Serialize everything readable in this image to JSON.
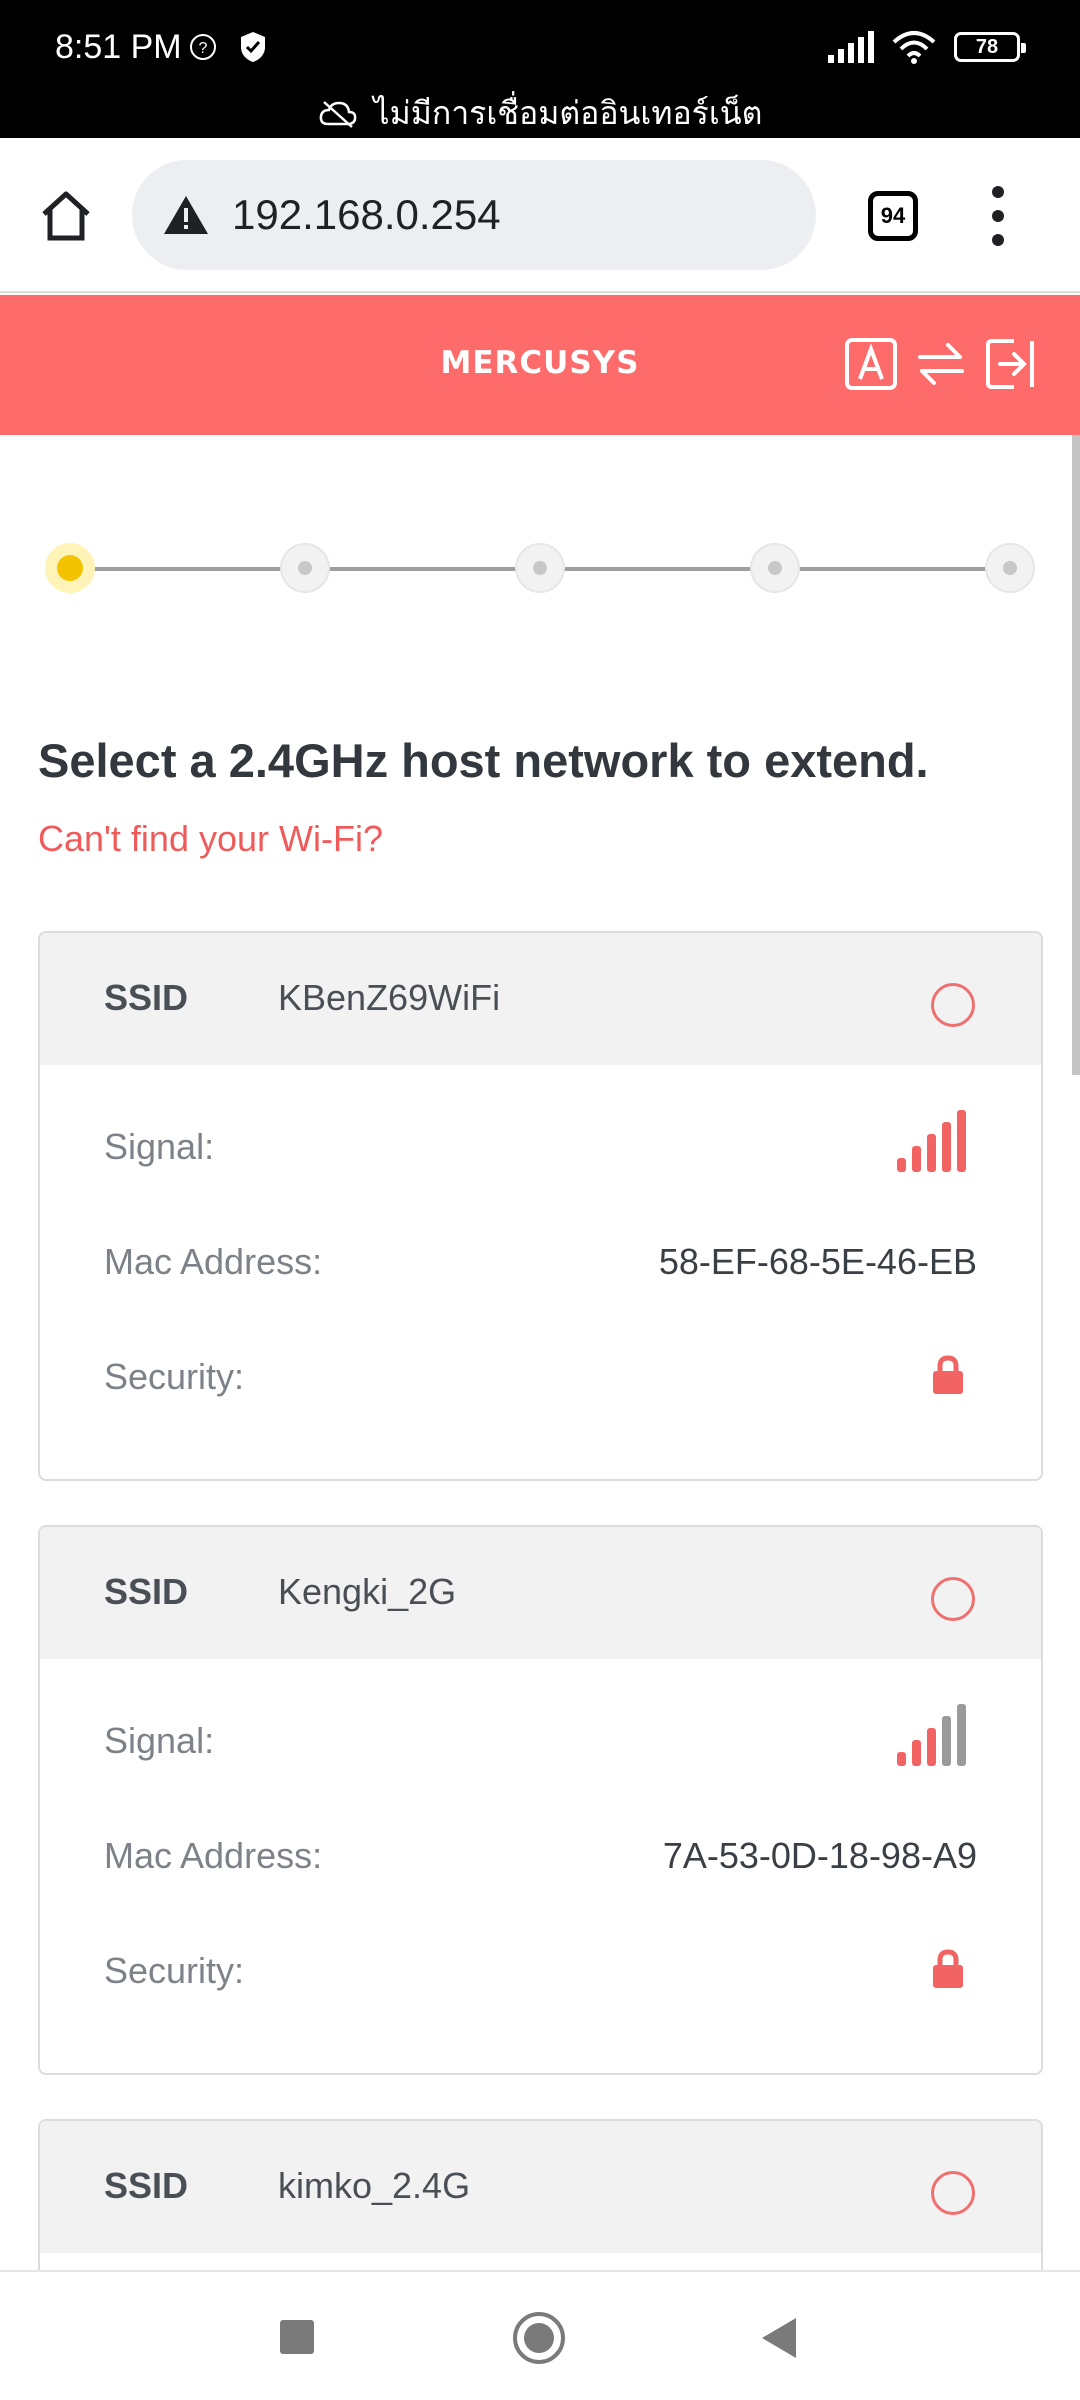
{
  "status_bar": {
    "time": "8:51 PM",
    "battery": "78",
    "notice": "ไม่มีการเชื่อมต่ออินเทอร์เน็ต",
    "icons": [
      "help-icon",
      "shield-icon",
      "cellular-signal-icon",
      "wifi-icon",
      "battery-icon",
      "cloud-off-icon"
    ]
  },
  "browser": {
    "url": "192.168.0.254",
    "tab_count": "94",
    "icons": [
      "home-icon",
      "warning-icon",
      "tabs-icon",
      "more-icon"
    ]
  },
  "header": {
    "brand": "MERCUSYS",
    "icons": [
      "language-icon",
      "switch-mode-icon",
      "logout-icon"
    ],
    "color": "#fd6b6b"
  },
  "wizard": {
    "steps_total": 5,
    "current_step": 1
  },
  "main": {
    "title": "Select a 2.4GHz host network to extend.",
    "help_link": "Can't find your Wi-Fi?"
  },
  "networks": [
    {
      "ssid_label": "SSID",
      "ssid": "KBenZ69WiFi",
      "signal_label": "Signal:",
      "signal_bars": 5,
      "mac_label": "Mac Address:",
      "mac": "58-EF-68-5E-46-EB",
      "security_label": "Security:",
      "secured": true
    },
    {
      "ssid_label": "SSID",
      "ssid": "Kengki_2G",
      "signal_label": "Signal:",
      "signal_bars": 3,
      "mac_label": "Mac Address:",
      "mac": "7A-53-0D-18-98-A9",
      "security_label": "Security:",
      "secured": true
    },
    {
      "ssid_label": "SSID",
      "ssid": "kimko_2.4G"
    }
  ],
  "colors": {
    "accent": "#ef5b5b",
    "step_active": "#f3c300",
    "signal_on": "#f26464",
    "signal_off": "#9a9a9a"
  },
  "nav": {
    "icons": [
      "recents-icon",
      "home-nav-icon",
      "back-icon"
    ]
  }
}
